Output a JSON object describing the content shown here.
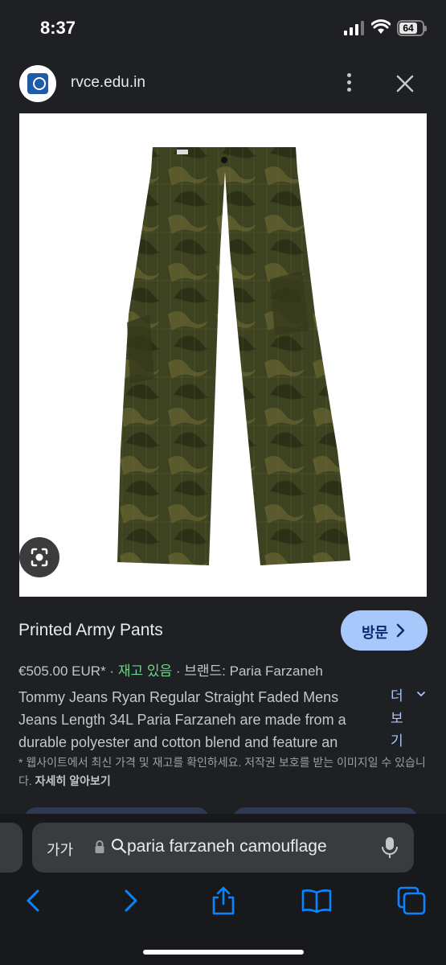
{
  "status_bar": {
    "time": "8:37",
    "battery": "64"
  },
  "header": {
    "domain": "rvce.edu.in"
  },
  "product": {
    "title": "Printed Army Pants",
    "visit_label": "방문",
    "price": "€505.00 EUR*",
    "separator": "·",
    "stock": "재고 있음",
    "brand": "브랜드: Paria Farzaneh",
    "description_lines": [
      "Tommy Jeans Ryan Regular Straight Faded Mens",
      "Jeans Length 34L Paria Farzaneh are made from a",
      "durable polyester and cotton blend and feature an"
    ],
    "more_label": "더보기",
    "notice": "* 웹사이트에서 최신 가격 및 재고를 확인하세요. 저작권 보호를 받는 이미지일 수 있습니다.",
    "learn_more": "자세히 알아보기"
  },
  "address_bar": {
    "text_size_label": "가가",
    "query": "paria farzaneh camouflage"
  },
  "colors": {
    "background": "#1f2024",
    "accent_button": "#a8c7fa",
    "in_stock": "#6dd58c",
    "link_blue": "#0a84ff"
  },
  "icons": [
    "menu-dots-icon",
    "close-icon",
    "google-lens-icon",
    "chevron-right-icon",
    "chevron-down-icon",
    "lock-icon",
    "search-icon",
    "mic-icon",
    "back-icon",
    "forward-icon",
    "share-icon",
    "bookmarks-icon",
    "tabs-icon"
  ]
}
